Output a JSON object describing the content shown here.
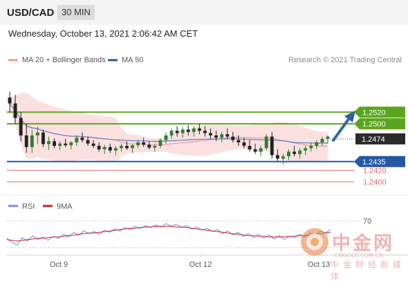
{
  "header": {
    "symbol": "USD/CAD",
    "timeframe": "30 MIN",
    "timestamp": "Wednesday, October 13, 2021 2:06:42 AM CET"
  },
  "legend": {
    "ma20_label": "MA 20 + Bollinger Bands",
    "ma50_label": "MA 50",
    "credit": "Research © 2021 Trading Central"
  },
  "rsi_legend": {
    "rsi_label": "RSI",
    "ma9_label": "9MA"
  },
  "watermark": {
    "cn": "中金网",
    "domain": "CNGOLD.COM.CN",
    "sub": "中金财经新媒体"
  },
  "colors": {
    "up_candle": "#2e7d32",
    "down_candle": "#222222",
    "ma20": "#f19a9a",
    "band_fill": "#fbe0e0",
    "ma50": "#5b7ec2",
    "resistance": "#5aa51e",
    "support": "#2457a6",
    "minor_level": "#e06666",
    "arrow": "#2f63a6",
    "rsi": "#6f8fe0",
    "rsi_ma": "#cc2222"
  },
  "chart_data": [
    {
      "type": "candlestick",
      "title": "USD/CAD",
      "ylim": [
        1.238,
        1.26
      ],
      "x_ticks": [
        "Oct 9",
        "Oct 12",
        "Oct 13"
      ],
      "series": [
        {
          "name": "MA 20 + Bollinger Bands",
          "kind": "moving_average_with_bands"
        },
        {
          "name": "MA 50",
          "kind": "moving_average"
        }
      ],
      "candles": [
        [
          1.2545,
          1.2555,
          1.252,
          1.2535
        ],
        [
          1.2535,
          1.255,
          1.25,
          1.251
        ],
        [
          1.251,
          1.252,
          1.247,
          1.248
        ],
        [
          1.248,
          1.25,
          1.245,
          1.246
        ],
        [
          1.246,
          1.249,
          1.245,
          1.248
        ],
        [
          1.248,
          1.2495,
          1.2465,
          1.2485
        ],
        [
          1.2485,
          1.249,
          1.246,
          1.2465
        ],
        [
          1.2465,
          1.2478,
          1.2455,
          1.247
        ],
        [
          1.247,
          1.2475,
          1.2458,
          1.2462
        ],
        [
          1.2462,
          1.247,
          1.2455,
          1.2466
        ],
        [
          1.2466,
          1.2474,
          1.246,
          1.2463
        ],
        [
          1.2463,
          1.247,
          1.2456,
          1.2468
        ],
        [
          1.2468,
          1.248,
          1.2462,
          1.2476
        ],
        [
          1.2476,
          1.2485,
          1.2468,
          1.2472
        ],
        [
          1.2472,
          1.2478,
          1.2462,
          1.2466
        ],
        [
          1.2466,
          1.2472,
          1.2458,
          1.2462
        ],
        [
          1.2462,
          1.2468,
          1.2452,
          1.2456
        ],
        [
          1.2456,
          1.2464,
          1.2448,
          1.246
        ],
        [
          1.246,
          1.2466,
          1.245,
          1.2454
        ],
        [
          1.2454,
          1.2462,
          1.2446,
          1.2458
        ],
        [
          1.2458,
          1.2466,
          1.2452,
          1.2462
        ],
        [
          1.2462,
          1.247,
          1.2455,
          1.2458
        ],
        [
          1.2458,
          1.2465,
          1.245,
          1.2463
        ],
        [
          1.2463,
          1.2472,
          1.2458,
          1.2468
        ],
        [
          1.2468,
          1.2476,
          1.246,
          1.2464
        ],
        [
          1.2464,
          1.247,
          1.2456,
          1.2459
        ],
        [
          1.2459,
          1.2466,
          1.2452,
          1.2462
        ],
        [
          1.2462,
          1.2475,
          1.2458,
          1.2472
        ],
        [
          1.2472,
          1.2485,
          1.2466,
          1.248
        ],
        [
          1.248,
          1.2492,
          1.2474,
          1.2488
        ],
        [
          1.2488,
          1.2496,
          1.2478,
          1.2484
        ],
        [
          1.2484,
          1.2494,
          1.2476,
          1.249
        ],
        [
          1.249,
          1.2498,
          1.248,
          1.2486
        ],
        [
          1.2486,
          1.2496,
          1.2478,
          1.2492
        ],
        [
          1.2492,
          1.25,
          1.2482,
          1.2488
        ],
        [
          1.2488,
          1.2496,
          1.2478,
          1.2484
        ],
        [
          1.2484,
          1.2492,
          1.2474,
          1.248
        ],
        [
          1.248,
          1.2488,
          1.247,
          1.2476
        ],
        [
          1.2476,
          1.2486,
          1.2468,
          1.2482
        ],
        [
          1.2482,
          1.2492,
          1.2474,
          1.2478
        ],
        [
          1.2478,
          1.2486,
          1.2468,
          1.2472
        ],
        [
          1.2472,
          1.248,
          1.2462,
          1.2468
        ],
        [
          1.2468,
          1.2476,
          1.2458,
          1.2462
        ],
        [
          1.2462,
          1.2472,
          1.2452,
          1.2456
        ],
        [
          1.2456,
          1.2466,
          1.2448,
          1.2452
        ],
        [
          1.2452,
          1.2462,
          1.2444,
          1.2458
        ],
        [
          1.2458,
          1.2482,
          1.2454,
          1.2478
        ],
        [
          1.2478,
          1.2486,
          1.244,
          1.2446
        ],
        [
          1.2446,
          1.2456,
          1.2436,
          1.244
        ],
        [
          1.244,
          1.2448,
          1.243,
          1.2444
        ],
        [
          1.2444,
          1.2456,
          1.2438,
          1.2452
        ],
        [
          1.2452,
          1.2462,
          1.2444,
          1.2448
        ],
        [
          1.2448,
          1.2458,
          1.244,
          1.2454
        ],
        [
          1.2454,
          1.2462,
          1.2446,
          1.2458
        ],
        [
          1.2458,
          1.2468,
          1.2452,
          1.2462
        ],
        [
          1.2462,
          1.2472,
          1.2456,
          1.2468
        ],
        [
          1.2468,
          1.2478,
          1.2462,
          1.2474
        ],
        [
          1.2474,
          1.248,
          1.2466,
          1.2478
        ]
      ],
      "levels": [
        {
          "value": "1.2520",
          "kind": "resistance"
        },
        {
          "value": "1.2500",
          "kind": "resistance"
        },
        {
          "value": "1.2474",
          "kind": "current"
        },
        {
          "value": "1.2435",
          "kind": "support"
        },
        {
          "value": "1.2420",
          "kind": "minor"
        },
        {
          "value": "1.2400",
          "kind": "minor"
        }
      ]
    },
    {
      "type": "line",
      "title": "RSI",
      "ylim": [
        20,
        80
      ],
      "y_ticks": [
        70
      ],
      "series": [
        {
          "name": "RSI",
          "values": [
            44,
            38,
            34,
            45,
            40,
            48,
            42,
            46,
            41,
            47,
            44,
            50,
            46,
            53,
            49,
            55,
            51,
            54,
            50,
            56,
            53,
            58,
            55,
            60,
            57,
            62,
            59,
            63,
            60,
            64,
            61,
            66,
            62,
            65,
            60,
            63,
            58,
            61,
            56,
            59,
            54,
            57,
            51,
            55,
            49,
            53,
            47,
            51,
            45,
            50,
            44,
            49,
            43,
            48,
            42,
            47,
            45,
            50,
            46,
            52,
            49,
            55,
            52,
            57
          ]
        },
        {
          "name": "9MA",
          "values": [
            42,
            41,
            40,
            41,
            42,
            43,
            44,
            44,
            45,
            46,
            46,
            47,
            48,
            49,
            50,
            51,
            52,
            52,
            53,
            54,
            55,
            56,
            57,
            58,
            59,
            59,
            60,
            61,
            61,
            62,
            62,
            62,
            62,
            61,
            61,
            60,
            59,
            58,
            57,
            56,
            55,
            54,
            53,
            52,
            51,
            50,
            49,
            48,
            48,
            47,
            47,
            46,
            46,
            46,
            46,
            47,
            47,
            48,
            48,
            49,
            50,
            51,
            52,
            53
          ]
        }
      ]
    }
  ]
}
